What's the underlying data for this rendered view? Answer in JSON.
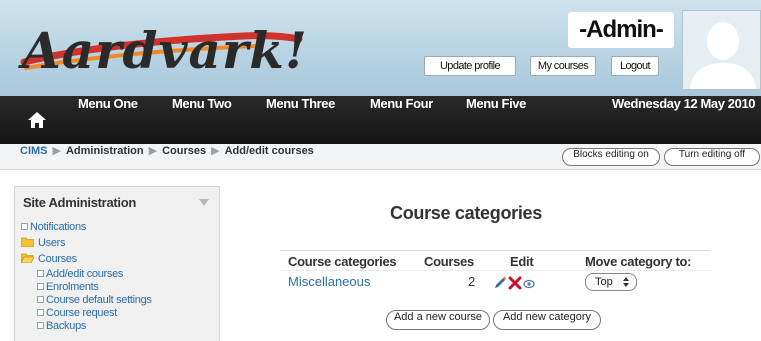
{
  "site": {
    "logo_text": "Aardvark!"
  },
  "user": {
    "name": "-Admin-"
  },
  "header_links": [
    "Update profile",
    "My courses",
    "Logout"
  ],
  "nav": {
    "items": [
      "Menu One",
      "Menu Two",
      "Menu Three",
      "Menu Four",
      "Menu Five"
    ],
    "date": "Wednesday 12 May 2010"
  },
  "breadcrumb": {
    "items": [
      "CIMS",
      "Administration",
      "Courses",
      "Add/edit courses"
    ],
    "separator": "▶"
  },
  "page_buttons": {
    "blocks_editing": "Blocks editing on",
    "turn_editing": "Turn editing off"
  },
  "sidebar": {
    "title": "Site Administration",
    "items": [
      {
        "label": "Notifications",
        "kind": "bullet"
      },
      {
        "label": "Users",
        "kind": "folder"
      },
      {
        "label": "Courses",
        "kind": "folder-open"
      },
      {
        "label": "Add/edit courses",
        "kind": "bullet-sub"
      },
      {
        "label": "Enrolments",
        "kind": "bullet-sub"
      },
      {
        "label": "Course default settings",
        "kind": "bullet-sub"
      },
      {
        "label": "Course request",
        "kind": "bullet-sub"
      },
      {
        "label": "Backups",
        "kind": "bullet-sub"
      }
    ]
  },
  "main": {
    "title": "Course categories",
    "columns": [
      "Course categories",
      "Courses",
      "Edit",
      "Move category to:"
    ],
    "rows": [
      {
        "category": "Miscellaneous",
        "courses": "2",
        "edit_icons": [
          "edit-icon",
          "delete-icon",
          "hide-icon"
        ],
        "move_to": "Top"
      }
    ],
    "buttons": {
      "add_course": "Add a new course",
      "add_category": "Add new category"
    }
  },
  "colors": {
    "link": "#2a6fa8",
    "navbar": "#1c1c1c",
    "header_bg": "#b7d2e2",
    "delete": "#c8102e"
  }
}
